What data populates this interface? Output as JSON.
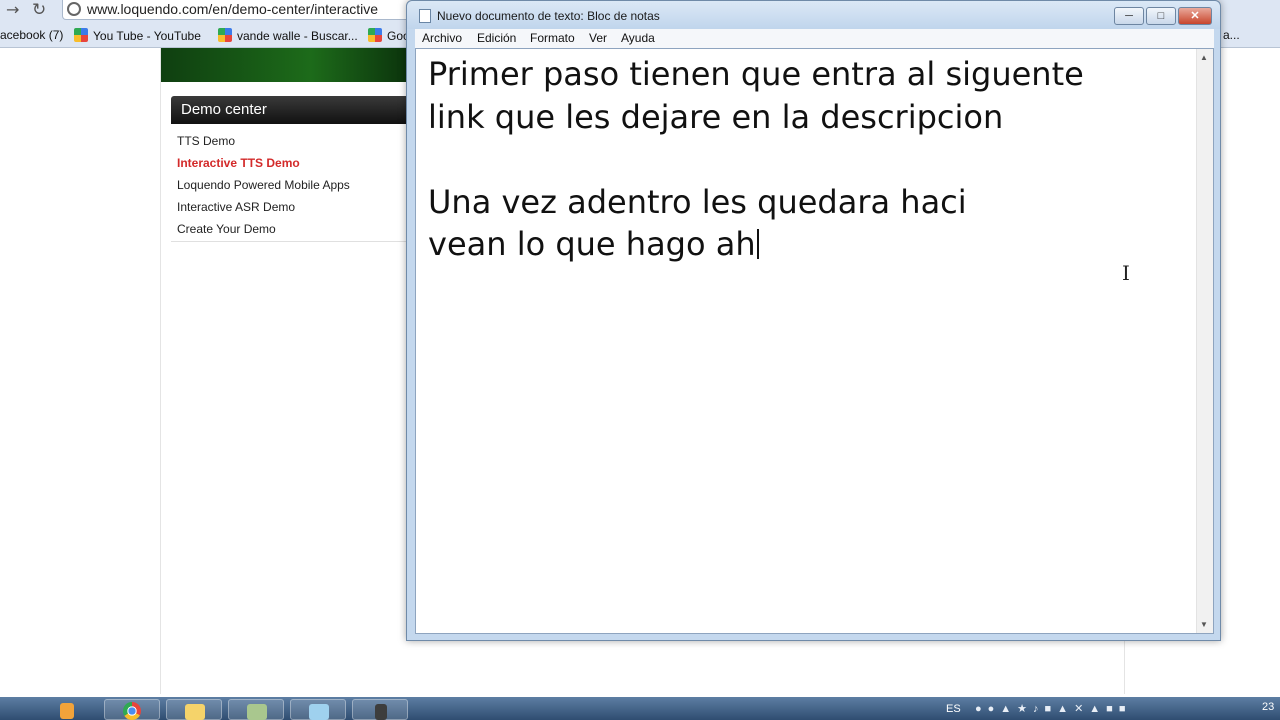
{
  "browser": {
    "back_icon": "arrow-left-icon",
    "refresh_icon": "refresh-icon",
    "url": "www.loquendo.com/en/demo-center/interactive",
    "bookmarks": [
      {
        "label": "acebook (7)"
      },
      {
        "label": "You Tube - YouTube"
      },
      {
        "label": "vande walle - Buscar..."
      },
      {
        "label": "Goo"
      }
    ],
    "overflow_label": "a..."
  },
  "webpage": {
    "demo_center": {
      "header": "Demo center",
      "links": [
        {
          "label": "TTS Demo",
          "active": false
        },
        {
          "label": "Interactive TTS Demo",
          "active": true
        },
        {
          "label": "Loquendo Powered Mobile Apps",
          "active": false
        },
        {
          "label": "Interactive ASR Demo",
          "active": false
        },
        {
          "label": "Create Your Demo",
          "active": false
        }
      ],
      "active_color": "#d32a2a"
    },
    "banner_color": "#1d6b1a"
  },
  "notepad": {
    "title": "Nuevo documento de texto: Bloc de notas",
    "menu": [
      "Archivo",
      "Edición",
      "Formato",
      "Ver",
      "Ayuda"
    ],
    "content": "Primer paso tienen que entra al siguente\nlink que les dejare en la descripcion\n\nUna vez adentro les quedara haci\nvean lo que hago ah",
    "buttons": {
      "minimize": "minimize-icon",
      "maximize": "maximize-icon",
      "close": "close-icon"
    }
  },
  "taskbar": {
    "language": "ES",
    "clock": "23",
    "apps": [
      "start-orb-icon",
      "chrome-icon",
      "explorer-folder-icon",
      "app-icon",
      "notepad-icon",
      "tool-icon"
    ]
  }
}
